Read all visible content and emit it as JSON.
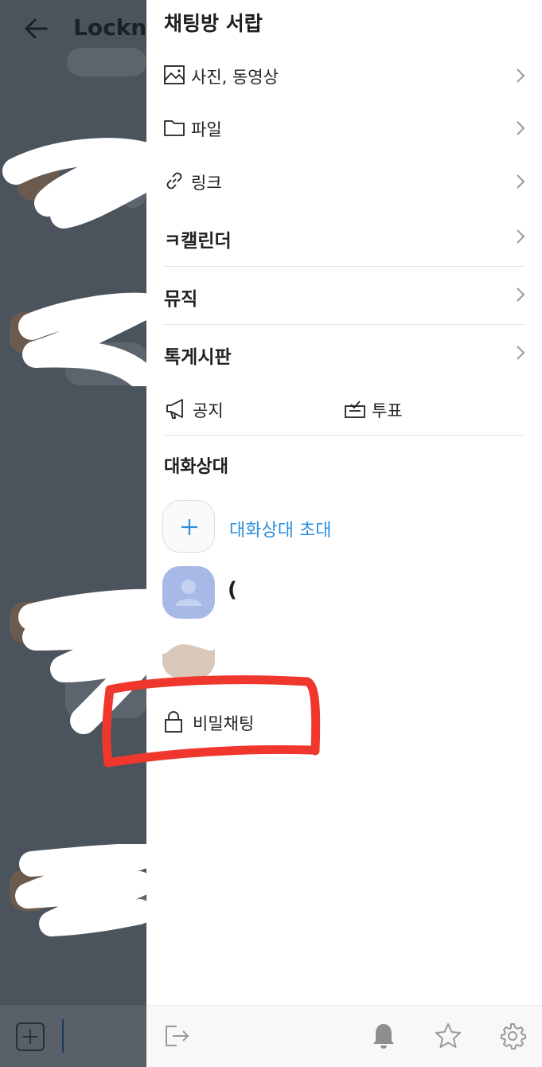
{
  "chat": {
    "title": "Lockne"
  },
  "drawer": {
    "title": "채팅방 서랍",
    "menu_items": [
      {
        "label": "사진, 동영상",
        "icon": "image-icon"
      },
      {
        "label": "파일",
        "icon": "folder-icon"
      },
      {
        "label": "링크",
        "icon": "link-icon"
      },
      {
        "label": "ㅋ캘린더",
        "icon": ""
      },
      {
        "label": "뮤직",
        "icon": ""
      },
      {
        "label": "톡게시판",
        "icon": ""
      }
    ],
    "notice_label": "공지",
    "vote_label": "투표",
    "members_title": "대화상대",
    "invite_label": "대화상대 초대",
    "member_name": "(",
    "secret_chat_label": "비밀채팅"
  },
  "colors": {
    "accent": "#2d8fe0",
    "overlay": "#4b535c",
    "annotation": "#f0372e",
    "avatar_blue": "#a7b9e6"
  }
}
